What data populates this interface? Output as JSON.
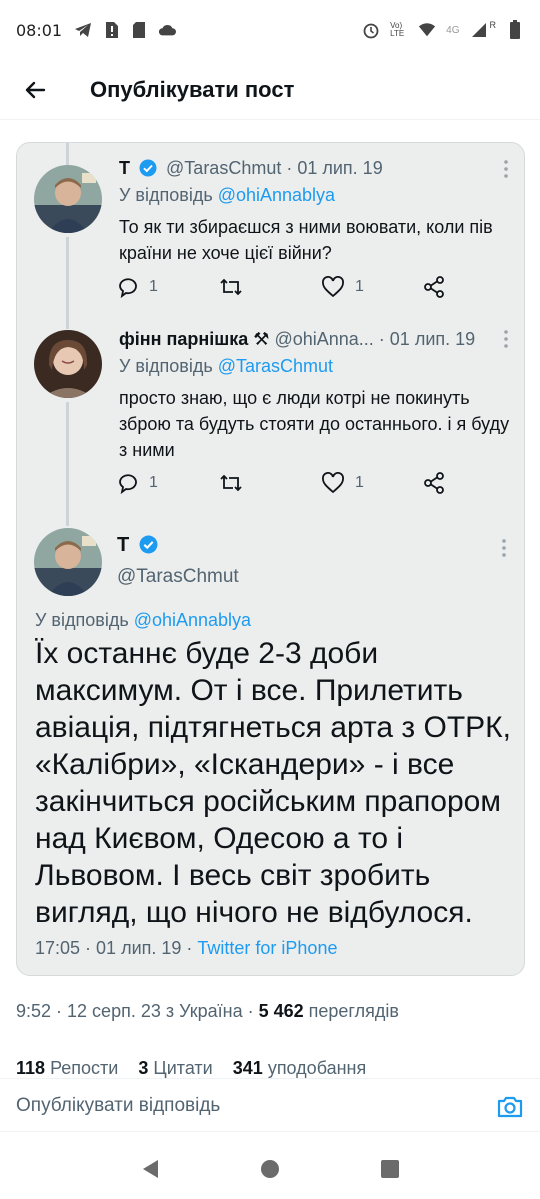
{
  "status_bar": {
    "time": "08:01",
    "network": "4G",
    "volte": "Vo) LTE",
    "roaming": "R"
  },
  "header": {
    "title": "Опублікувати пост"
  },
  "embedded_thread": {
    "tweet1": {
      "name": "T",
      "handle": "@TarasChmut",
      "date": "· 01 лип. 19",
      "reply_prefix": "У відповідь",
      "reply_to": "@ohiAnnablya",
      "text": "То як ти збираєшся з ними воювати, коли пів країни не хоче цієї війни?",
      "replies": "1",
      "likes": "1"
    },
    "tweet2": {
      "name": "фінн парнішка ⚒",
      "handle": "@ohiAnna...",
      "date": "· 01 лип. 19",
      "reply_prefix": "У відповідь",
      "reply_to": "@TarasChmut",
      "text": "просто знаю, що є люди котрі не покинуть зброю та будуть стояти до останнього. і я буду з ними",
      "replies": "1",
      "likes": "1"
    },
    "tweet3": {
      "name": "T",
      "handle": "@TarasChmut",
      "reply_prefix": "У відповідь",
      "reply_to": "@ohiAnnablya",
      "text": "Їх останнє буде 2-3 доби максимум. От і все. Прилетить авіація, підтягнеться арта з ОТРК, «Калібри», «Іскандери» - і все закінчиться російським прапором над Києвом, Одесою а то і Львовом. І весь світ зробить вигляд, що нічого не відбулося.",
      "timestamp": "17:05 · 01 лип. 19 ·",
      "source": "Twitter for iPhone"
    }
  },
  "post_meta": {
    "time_place": "9:52 · 12 серп. 23 з Україна ·",
    "views_count": "5 462",
    "views_label": "переглядів"
  },
  "stats": {
    "reposts_count": "118",
    "reposts_label": "Репости",
    "quotes_count": "3",
    "quotes_label": "Цитати",
    "likes_count": "341",
    "likes_label": "уподобання"
  },
  "reply_bar": {
    "placeholder": "Опублікувати відповідь"
  },
  "colors": {
    "accent": "#1d9bf0",
    "text_secondary": "#536471",
    "card_bg": "#eceeee"
  }
}
